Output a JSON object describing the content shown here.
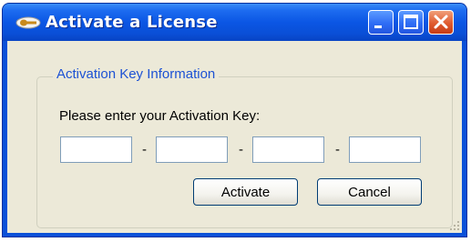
{
  "window": {
    "title": "Activate a License",
    "app_icon": "key-icon",
    "controls": [
      "minimize-icon",
      "maximize-icon",
      "close-icon"
    ]
  },
  "group": {
    "legend": "Activation Key Information",
    "prompt": "Please enter your Activation Key:",
    "key_fields": [
      {
        "value": "",
        "placeholder": ""
      },
      {
        "value": "",
        "placeholder": ""
      },
      {
        "value": "",
        "placeholder": ""
      },
      {
        "value": "",
        "placeholder": ""
      }
    ],
    "separator": "-"
  },
  "buttons": {
    "activate_label": "Activate",
    "cancel_label": "Cancel"
  },
  "colors": {
    "titlebar": "#0a56e4",
    "close_button": "#e05b2f",
    "dialog_background": "#ece9d8",
    "legend_text": "#1d52d4"
  }
}
